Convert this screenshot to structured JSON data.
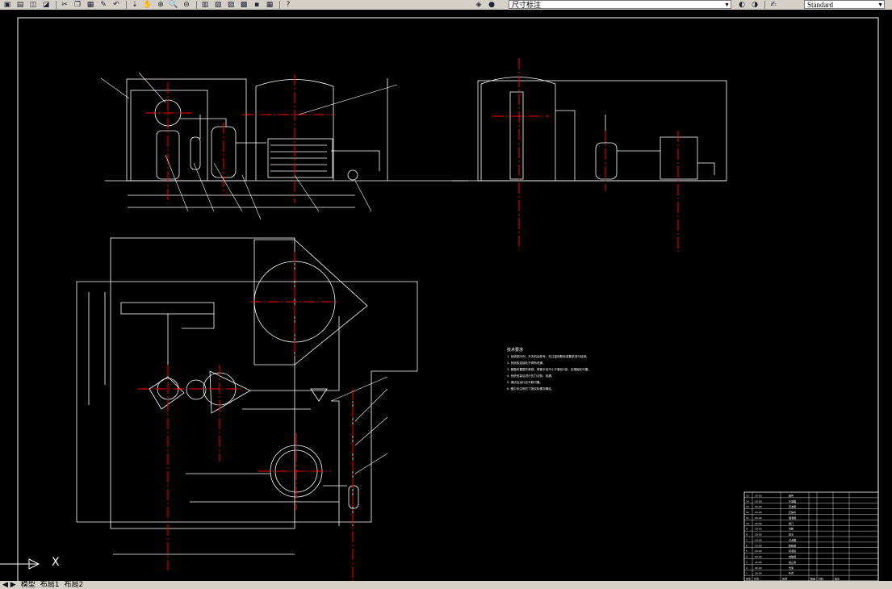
{
  "toolbar": {
    "dimension_style": "尺寸标注",
    "text_style": "Standard",
    "buttons": [
      "open-icon",
      "print-icon",
      "preview-icon",
      "publish-icon",
      "cut-icon",
      "copy-icon",
      "paste-icon",
      "matchprop-icon",
      "undo-icon",
      "redo-icon",
      "pan-icon",
      "zoom-realtime-icon",
      "zoom-window-icon",
      "zoom-previous-icon",
      "properties-icon",
      "designcenter-icon",
      "toolpalette-icon",
      "sheetset-icon",
      "markup-icon",
      "calculator-icon",
      "help-icon",
      "layer-icon",
      "layer-state-icon",
      "layer-prev-icon",
      "style-icon"
    ]
  },
  "notes": {
    "title": "技术要求",
    "lines": [
      "1. 系统制冷剂、冷冻机油型号、充注量按照标准要求进行检测。",
      "2. 系统各连接处不得有泄漏。",
      "3. 管路布置整齐美观，弯管半径不小于管径3倍，支撑固定可靠。",
      "4. 系统安装后进行压力试验、检漏。",
      "5. 调试后运行应平稳可靠。",
      "6. 图中未注明尺寸按实际情况确定。"
    ]
  },
  "title_block": {
    "rows": [
      [
        "20-00",
        "部件"
      ],
      [
        "20-00",
        "冷凝器"
      ],
      [
        "20-00",
        "蒸发器"
      ],
      [
        "20-00",
        "压缩机"
      ],
      [
        "20-00",
        "储液器"
      ],
      [
        "20-00",
        "阀门"
      ],
      [
        "20-00",
        "管路"
      ],
      [
        "20-00",
        "接头"
      ],
      [
        "20-00",
        "过滤器"
      ],
      [
        "20-00",
        "膨胀阀"
      ],
      [
        "20-00",
        "视液镜"
      ],
      [
        "20-00",
        "电磁阀"
      ],
      [
        "20-00",
        "截止阀"
      ],
      [
        "20-00",
        "支架"
      ],
      [
        "20-00",
        "外壳"
      ]
    ],
    "footer": [
      "序号",
      "代号",
      "名称",
      "数量",
      "材料",
      "备注"
    ]
  },
  "ucs": {
    "axis_label": "X"
  },
  "layout_tabs": [
    "模型",
    "布局1",
    "布局2"
  ]
}
